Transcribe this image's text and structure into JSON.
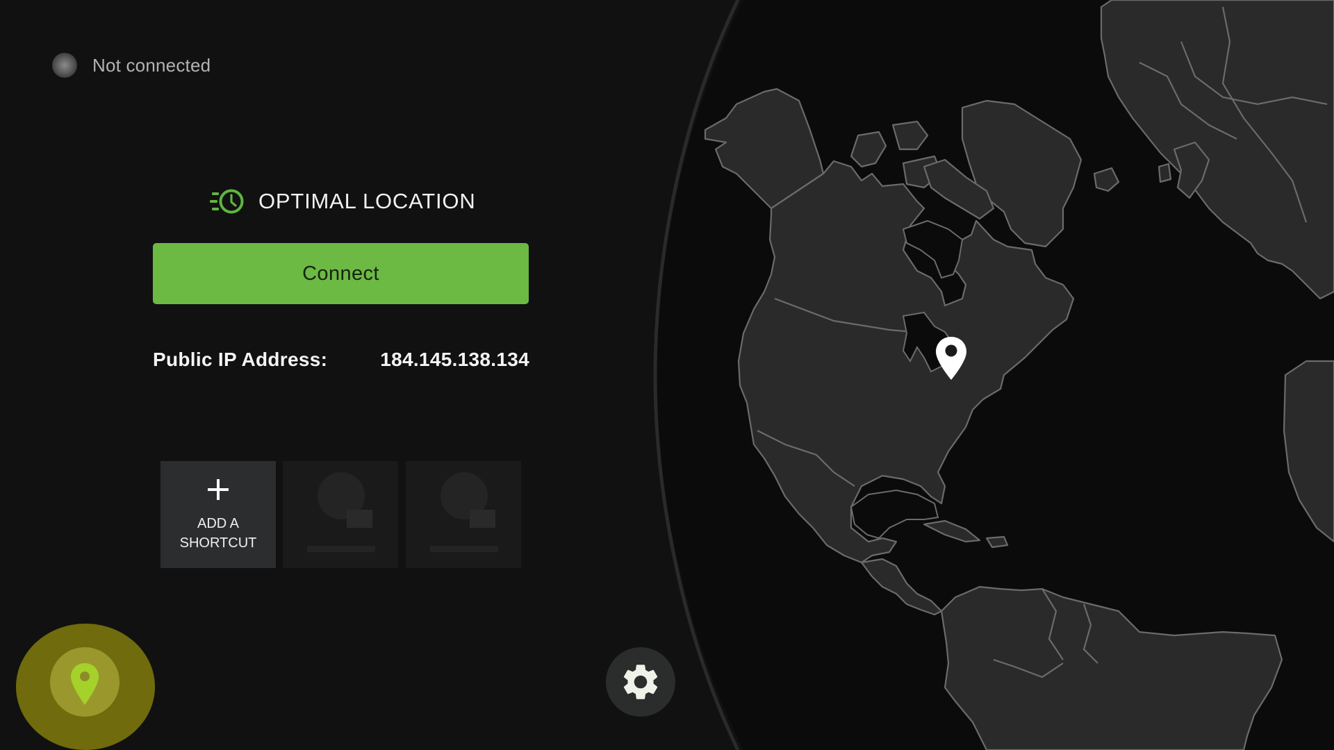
{
  "status": {
    "text": "Not connected",
    "indicator_color": "#5c5c5c"
  },
  "location": {
    "icon": "speed-clock-icon",
    "label": "OPTIMAL LOCATION",
    "icon_color": "#5fb541"
  },
  "connect": {
    "label": "Connect",
    "color": "#6cb944"
  },
  "ip": {
    "label": "Public IP Address:",
    "value": "184.145.138.134"
  },
  "shortcuts": {
    "add_label_line1": "ADD A",
    "add_label_line2": "SHORTCUT",
    "add_icon": "plus-icon",
    "placeholders": 2
  },
  "fab": {
    "icon": "location-pin-icon",
    "color": "#a4d22a"
  },
  "settings": {
    "icon": "gear-icon"
  },
  "map": {
    "pin_icon": "map-pin-icon",
    "land_color": "#2a2a2a",
    "border_color": "#6b6b6b",
    "ocean_color": "#0b0b0b"
  }
}
